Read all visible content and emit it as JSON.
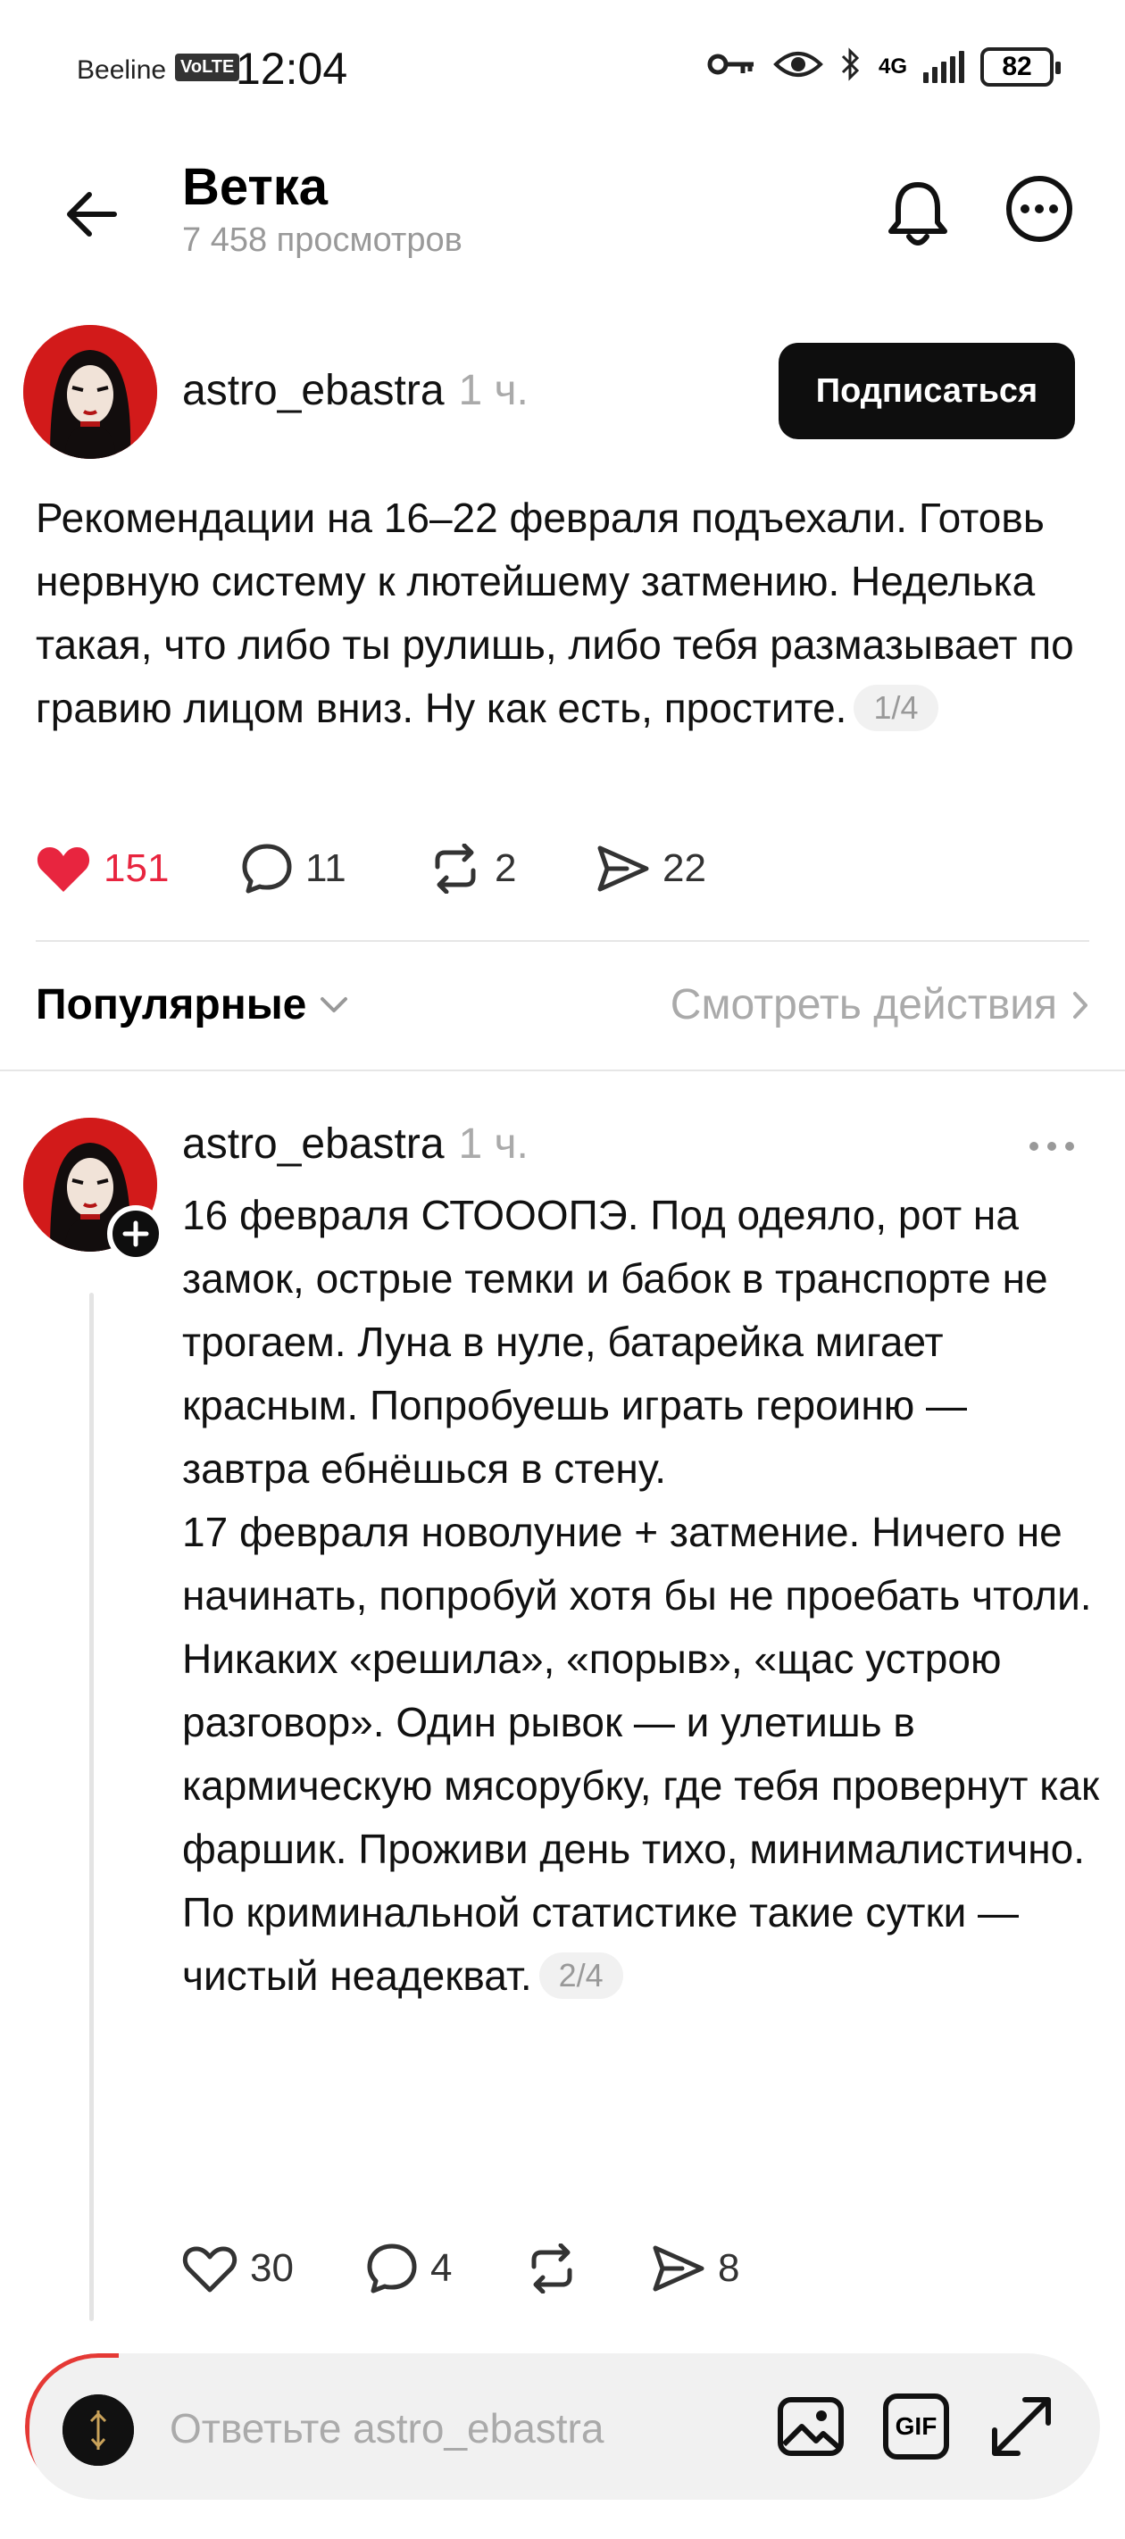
{
  "status_bar": {
    "carrier": "Beeline",
    "volte": "VoLTE",
    "time": "12:04",
    "network": "4G",
    "battery": "82"
  },
  "header": {
    "title": "Ветка",
    "views": "7 458 просмотров"
  },
  "post": {
    "author": "astro_ebastra",
    "time": "1 ч.",
    "subscribe_label": "Подписаться",
    "text": "Рекомендации на 16–22 февраля подъехали. Готовь нервную систему к лютейшему затмению. Неделька такая, что либо ты рулишь, либо тебя размазывает по гравию лицом вниз. Ну как есть, простите.",
    "pager": "1/4",
    "likes": "151",
    "comments": "11",
    "reposts": "2",
    "shares": "22"
  },
  "sort": {
    "label": "Популярные",
    "view_actions": "Смотреть действия"
  },
  "reply": {
    "author": "astro_ebastra",
    "time": "1 ч.",
    "text": "16 февраля СТОООПЭ. Под одеяло, рот на замок, острые темки и бабок в транспорте не трогаем. Луна в нуле, батарейка мигает красным. Попробуешь играть героиню — завтра ебнёшься в стену.\n17 февраля новолуние + затмение. Ничего не начинать, попробуй хотя бы не проебать чтоли. Никаких «решила», «порыв», «щас устрою разговор». Один рывок — и улетишь в кармическую мясорубку, где тебя провернут как фаршик. Проживи день тихо, минималистично. По криминальной статистике такие сутки — чистый неадекват.",
    "pager": "2/4",
    "likes": "30",
    "comments": "4",
    "shares": "8"
  },
  "reply_bar": {
    "placeholder": "Ответьте astro_ebastra",
    "gif_label": "GIF"
  },
  "colors": {
    "like_red": "#e8253f",
    "avatar_red": "#d21a1a",
    "button_dark": "#0e0e0e",
    "muted": "#999999"
  }
}
